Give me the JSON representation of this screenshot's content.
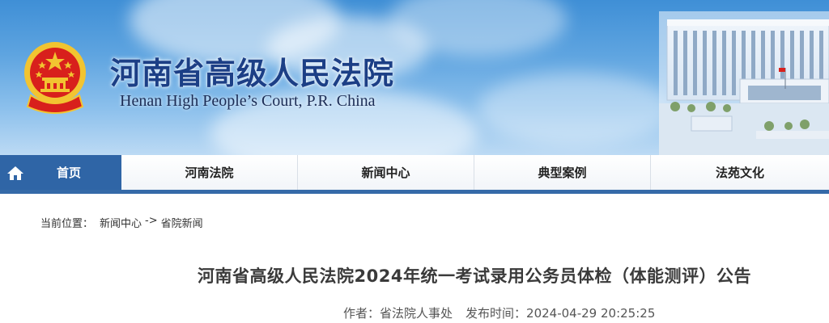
{
  "header": {
    "title_cn": "河南省高级人民法院",
    "title_en": "Henan High People’s Court, P.R. China"
  },
  "nav": {
    "items": [
      {
        "label": "首页",
        "icon": "home-icon"
      },
      {
        "label": "河南法院"
      },
      {
        "label": "新闻中心"
      },
      {
        "label": "典型案例"
      },
      {
        "label": "法苑文化"
      }
    ]
  },
  "breadcrumb": {
    "prefix": "当前位置：",
    "items": [
      "新闻中心",
      "省院新闻"
    ],
    "separator": "->"
  },
  "article": {
    "title": "河南省高级人民法院2024年统一考试录用公务员体检（体能测评）公告",
    "author_label": "作者：",
    "author": "省法院人事处",
    "date_label": "发布时间：",
    "date": "2024-04-29 20:25:25"
  },
  "colors": {
    "nav_active": "#2f65a6",
    "nav_border": "#356aa8",
    "title_cn": "#1c3f86",
    "emblem_red": "#d8201c",
    "emblem_gold": "#f2c431"
  }
}
